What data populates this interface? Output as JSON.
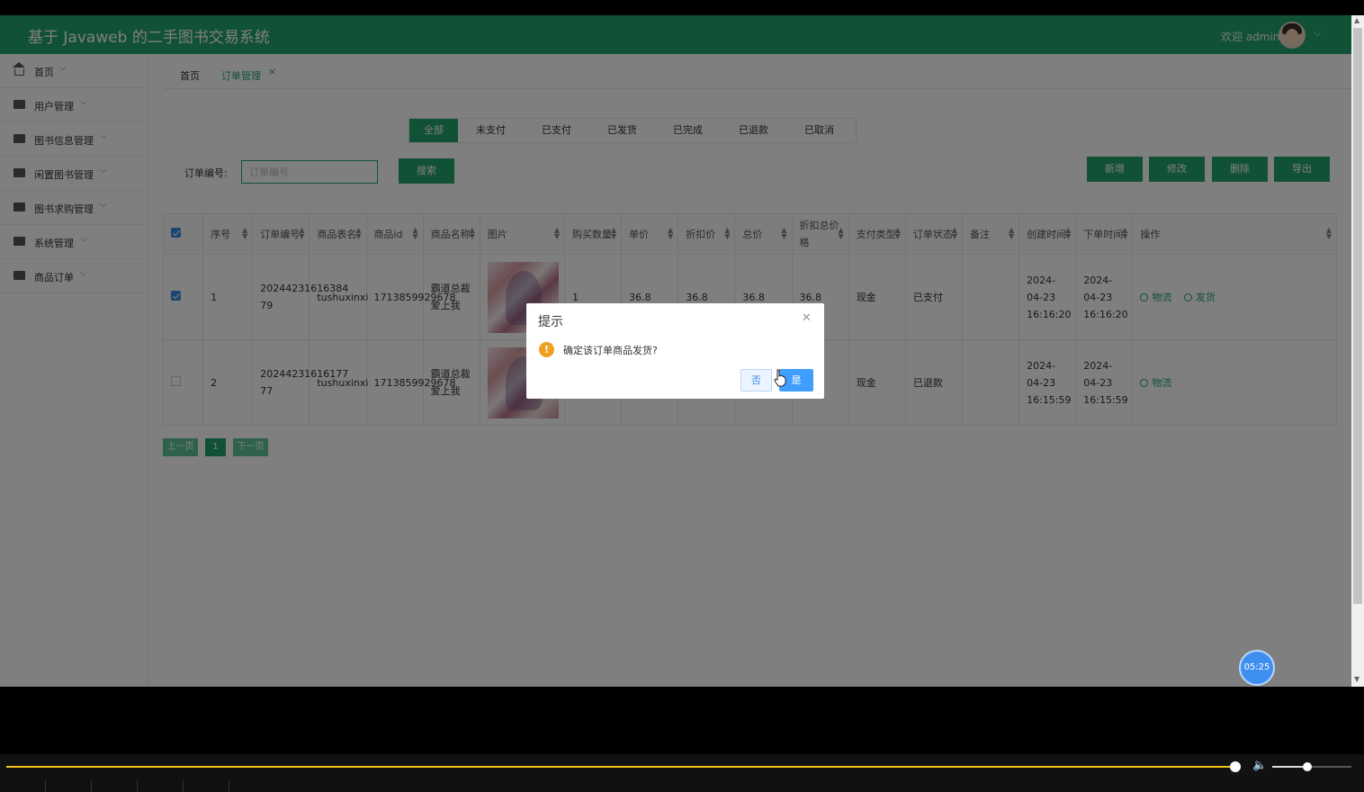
{
  "app": {
    "title": "基于 Javaweb 的二手图书交易系统",
    "welcome": "欢迎 admin"
  },
  "sidebar": {
    "items": [
      {
        "label": "首页",
        "icon": "home-icon"
      },
      {
        "label": "用户管理",
        "icon": "menu-icon"
      },
      {
        "label": "图书信息管理",
        "icon": "menu-icon"
      },
      {
        "label": "闲置图书管理",
        "icon": "menu-icon"
      },
      {
        "label": "图书求购管理",
        "icon": "menu-icon"
      },
      {
        "label": "系统管理",
        "icon": "menu-icon"
      },
      {
        "label": "商品订单",
        "icon": "menu-icon"
      }
    ]
  },
  "tabs": {
    "home": "首页",
    "current": "订单管理",
    "close": "×"
  },
  "status_tabs": [
    "全部",
    "未支付",
    "已支付",
    "已发货",
    "已完成",
    "已退款",
    "已取消"
  ],
  "search": {
    "label": "订单编号:",
    "placeholder": "订单编号",
    "button": "搜索"
  },
  "toolbar": {
    "add": "新增",
    "edit": "修改",
    "delete": "删除",
    "export": "导出"
  },
  "table": {
    "headers": [
      "序号",
      "订单编号",
      "商品表名",
      "商品id",
      "商品名称",
      "图片",
      "购买数量",
      "单价",
      "折扣价",
      "总价",
      "折扣总价格",
      "支付类型",
      "订单状态",
      "备注",
      "创建时间",
      "下单时间",
      "操作"
    ],
    "rows": [
      {
        "checked": true,
        "index": "1",
        "order_no": "20244231616384 79",
        "table_name": "tushuxinxi",
        "goods_id": "1713859929678",
        "goods_name": "霸道总裁爱上我",
        "qty": "1",
        "price": "36.8",
        "discount_price": "36.8",
        "total": "36.8",
        "discount_total": "36.8",
        "pay_type": "现金",
        "status": "已支付",
        "remark": "",
        "created": "2024-04-23 16:16:20",
        "ordered": "2024-04-23 16:16:20",
        "ops": [
          "物流",
          "发货"
        ]
      },
      {
        "checked": false,
        "index": "2",
        "order_no": "20244231616177 77",
        "table_name": "tushuxinxi",
        "goods_id": "1713859929678",
        "goods_name": "霸道总裁爱上我",
        "qty": "",
        "price": "",
        "discount_price": "",
        "total": "",
        "discount_total": "",
        "pay_type": "现金",
        "status": "已退款",
        "remark": "",
        "created": "2024-04-23 16:15:59",
        "ordered": "2024-04-23 16:15:59",
        "ops": [
          "物流"
        ]
      }
    ]
  },
  "pager": {
    "prev": "上一页",
    "page": "1",
    "next": "下一页"
  },
  "dialog": {
    "title": "提示",
    "message": "确定该订单商品发货?",
    "no": "否",
    "yes": "是"
  },
  "timer": "05:25",
  "colors": {
    "brand": "#23a26d",
    "primary": "#409eff",
    "warning": "#f0a020",
    "progress": "#f0c419"
  }
}
